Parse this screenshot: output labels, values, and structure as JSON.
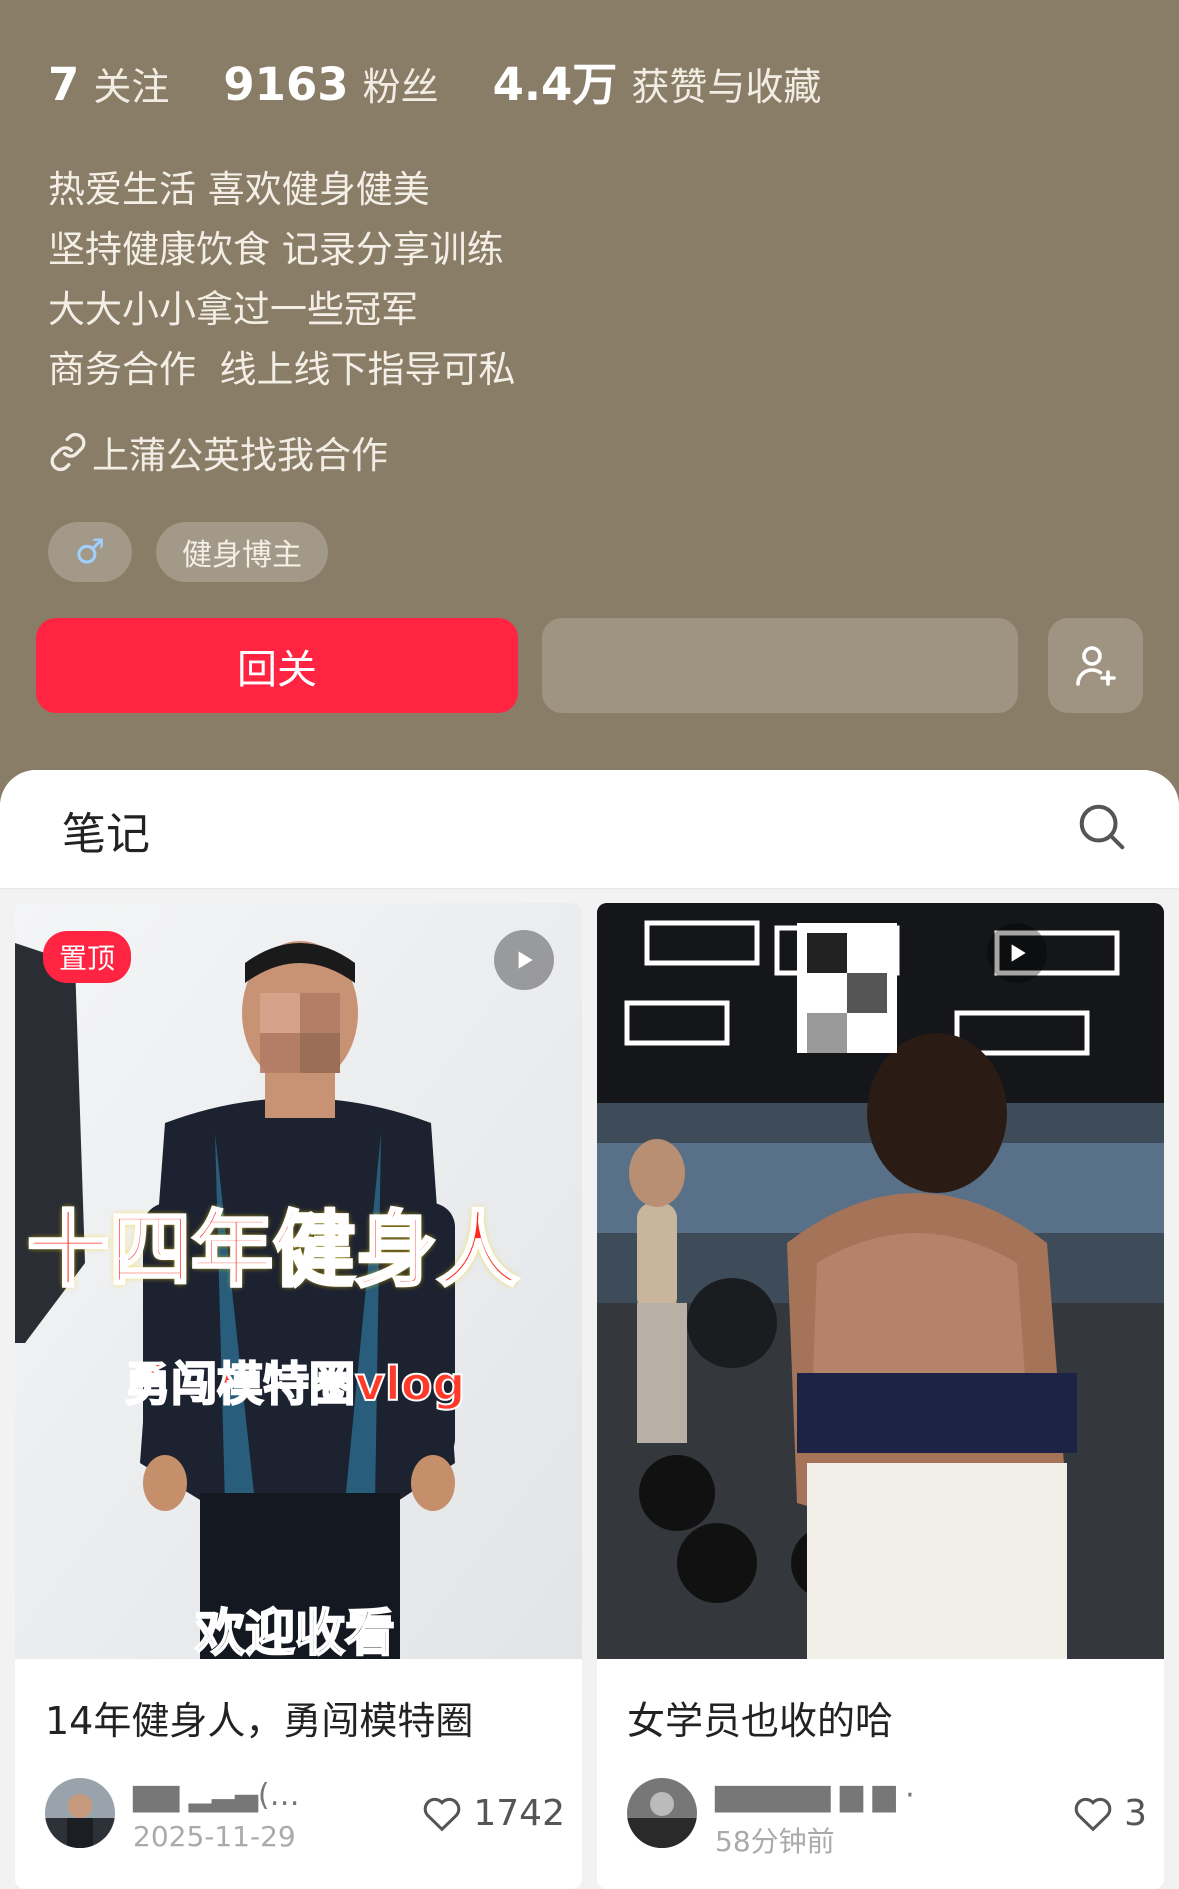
{
  "profile": {
    "stats": [
      {
        "value": "7",
        "label": "关注"
      },
      {
        "value": "9163",
        "label": "粉丝"
      },
      {
        "value": "4.4万",
        "label": "获赞与收藏"
      }
    ],
    "bio": [
      "热爱生活 喜欢健身健美",
      "坚持健康饮食 记录分享训练",
      "大大小小拿过一些冠军",
      "商务合作  线上线下指导可私"
    ],
    "link_text": "上蒲公英找我合作",
    "gender_symbol": "♂",
    "tag": "健身博主",
    "follow_back_label": "回关",
    "accent_color": "#ff2442"
  },
  "notes_panel": {
    "tab_label": "笔记",
    "cards": [
      {
        "pinned_label": "置顶",
        "cover_text_big": "十四年健身人",
        "cover_text_mid": "勇闯模特圈vlog",
        "cover_text_bottom": "欢迎收看",
        "title": "14年健身人，勇闯模特圈",
        "author": "▆▆  ▂▃▄(…",
        "date": "2025-11-29",
        "likes": "1742"
      },
      {
        "title": "女学员也收的哈",
        "author": "▆▆▆▆▆  ▆    ▆ ·",
        "date": "58分钟前",
        "likes": "3"
      }
    ]
  }
}
